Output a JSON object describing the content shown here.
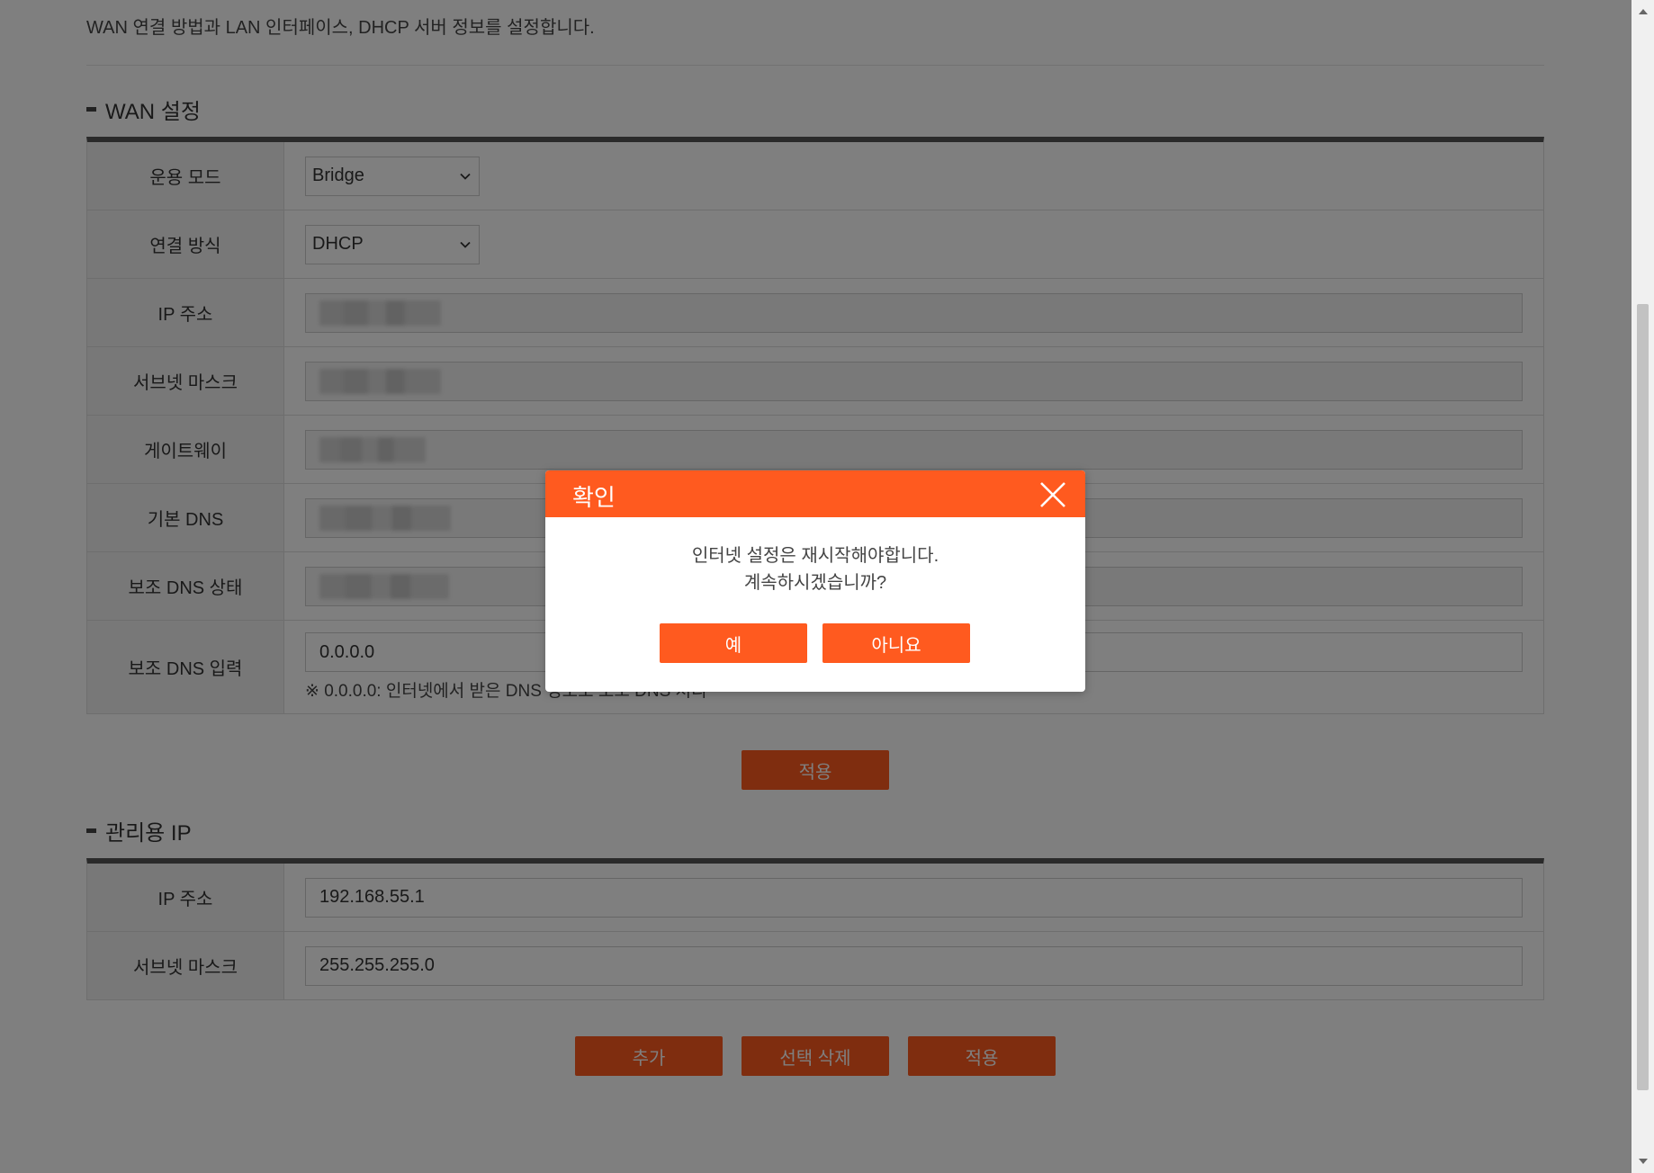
{
  "description": "WAN 연결 방법과 LAN 인터페이스, DHCP 서버 정보를 설정합니다.",
  "wan": {
    "title": "WAN 설정",
    "mode_label": "운용 모드",
    "mode_value": "Bridge",
    "conn_label": "연결 방식",
    "conn_value": "DHCP",
    "ip_label": "IP 주소",
    "subnet_label": "서브넷 마스크",
    "gateway_label": "게이트웨이",
    "dns1_label": "기본 DNS",
    "dns2_state_label": "보조 DNS 상태",
    "dns2_input_label": "보조 DNS 입력",
    "dns2_input_value": "0.0.0.0",
    "dns2_hint": "※ 0.0.0.0: 인터넷에서 받은 DNS 정보로 보조 DNS 처리",
    "apply_label": "적용"
  },
  "mgmt": {
    "title": "관리용 IP",
    "ip_label": "IP 주소",
    "ip_value": "192.168.55.1",
    "subnet_label": "서브넷 마스크",
    "subnet_value": "255.255.255.0",
    "add_label": "추가",
    "delete_label": "선택 삭제",
    "apply_label": "적용"
  },
  "dialog": {
    "title": "확인",
    "line1": "인터넷 설정은 재시작해야합니다.",
    "line2": "계속하시겠습니까?",
    "yes_label": "예",
    "no_label": "아니요"
  },
  "colors": {
    "accent": "#ff5a1f",
    "overlay": "rgba(0,0,0,0.5)"
  }
}
